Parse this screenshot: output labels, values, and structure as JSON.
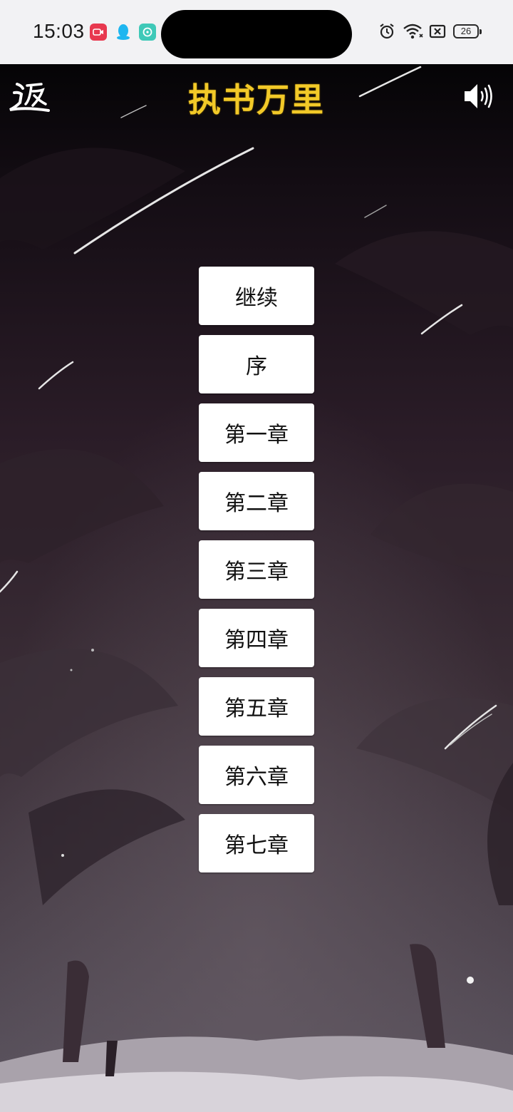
{
  "status_bar": {
    "time": "15:03",
    "notifications": [
      {
        "icon": "video-app-icon",
        "color": "#e8384f"
      },
      {
        "icon": "qq-penguin-icon",
        "color": "#1eb6f0"
      },
      {
        "icon": "chat-bubble-app-icon",
        "color": "#3fc9b8"
      }
    ],
    "right_icons": [
      "alarm-icon",
      "wifi-icon",
      "no-sim-icon"
    ],
    "battery": "26"
  },
  "header": {
    "back_icon": "back-calligraphy-icon",
    "title": "执书万里",
    "sound_icon": "speaker-icon"
  },
  "menu": {
    "items": [
      "继续",
      "序",
      "第一章",
      "第二章",
      "第三章",
      "第四章",
      "第五章",
      "第六章",
      "第七章"
    ]
  },
  "colors": {
    "title": "#f2c928",
    "button_bg": "#ffffff",
    "button_text": "#111111",
    "status_bar_bg": "#f2f2f4"
  }
}
